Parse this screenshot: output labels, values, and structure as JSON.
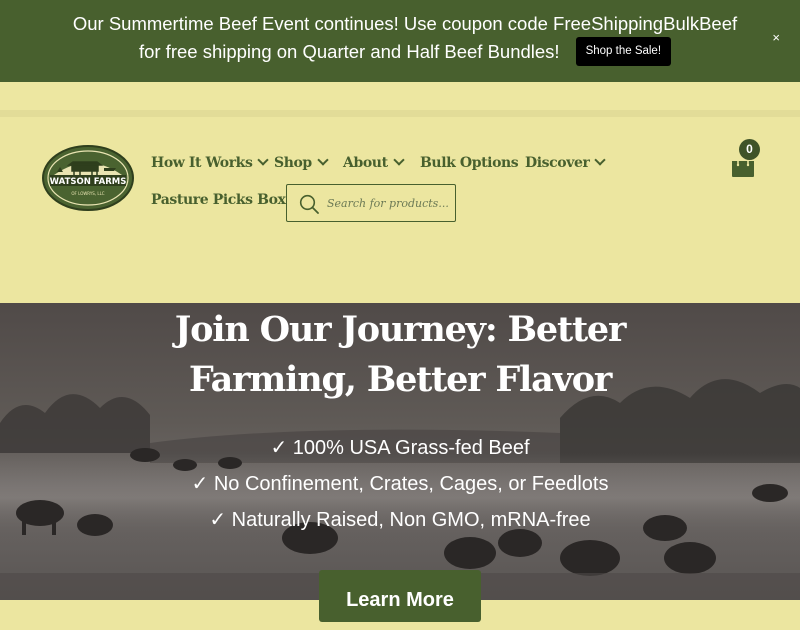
{
  "announcement": {
    "text": "Our Summertime Beef Event continues! Use coupon code FreeShippingBulkBeef for free shipping on Quarter and Half Beef Bundles!",
    "button_label": "Shop the Sale!",
    "close_label": "×"
  },
  "header": {
    "logo": {
      "name": "WATSON FARMS",
      "subtitle": "OF LOWRYS, LLC"
    },
    "nav": [
      {
        "label": "How It Works",
        "dropdown": true
      },
      {
        "label": "Shop",
        "dropdown": true
      },
      {
        "label": "About",
        "dropdown": true
      },
      {
        "label": "Bulk Options",
        "dropdown": false
      },
      {
        "label": "Discover",
        "dropdown": true
      },
      {
        "label": "Pasture Picks Box",
        "dropdown": false
      }
    ],
    "search": {
      "placeholder": "Search for products..."
    },
    "cart": {
      "count": "0"
    }
  },
  "hero": {
    "title": "Join Our Journey: Better Farming, Better Flavor",
    "bullets": [
      "✓ 100% USA Grass-fed Beef",
      "✓ No Confinement, Crates, Cages, or Feedlots",
      "✓ Naturally Raised, Non GMO, mRNA-free"
    ],
    "cta_label": "Learn More"
  },
  "colors": {
    "brand_green": "#48602e",
    "header_bg": "#ece6a0",
    "button_black": "#000000"
  },
  "icons": {
    "close": "close-icon",
    "chevron": "chevron-down-icon",
    "search": "search-icon",
    "cart": "shopping-bag-icon"
  }
}
